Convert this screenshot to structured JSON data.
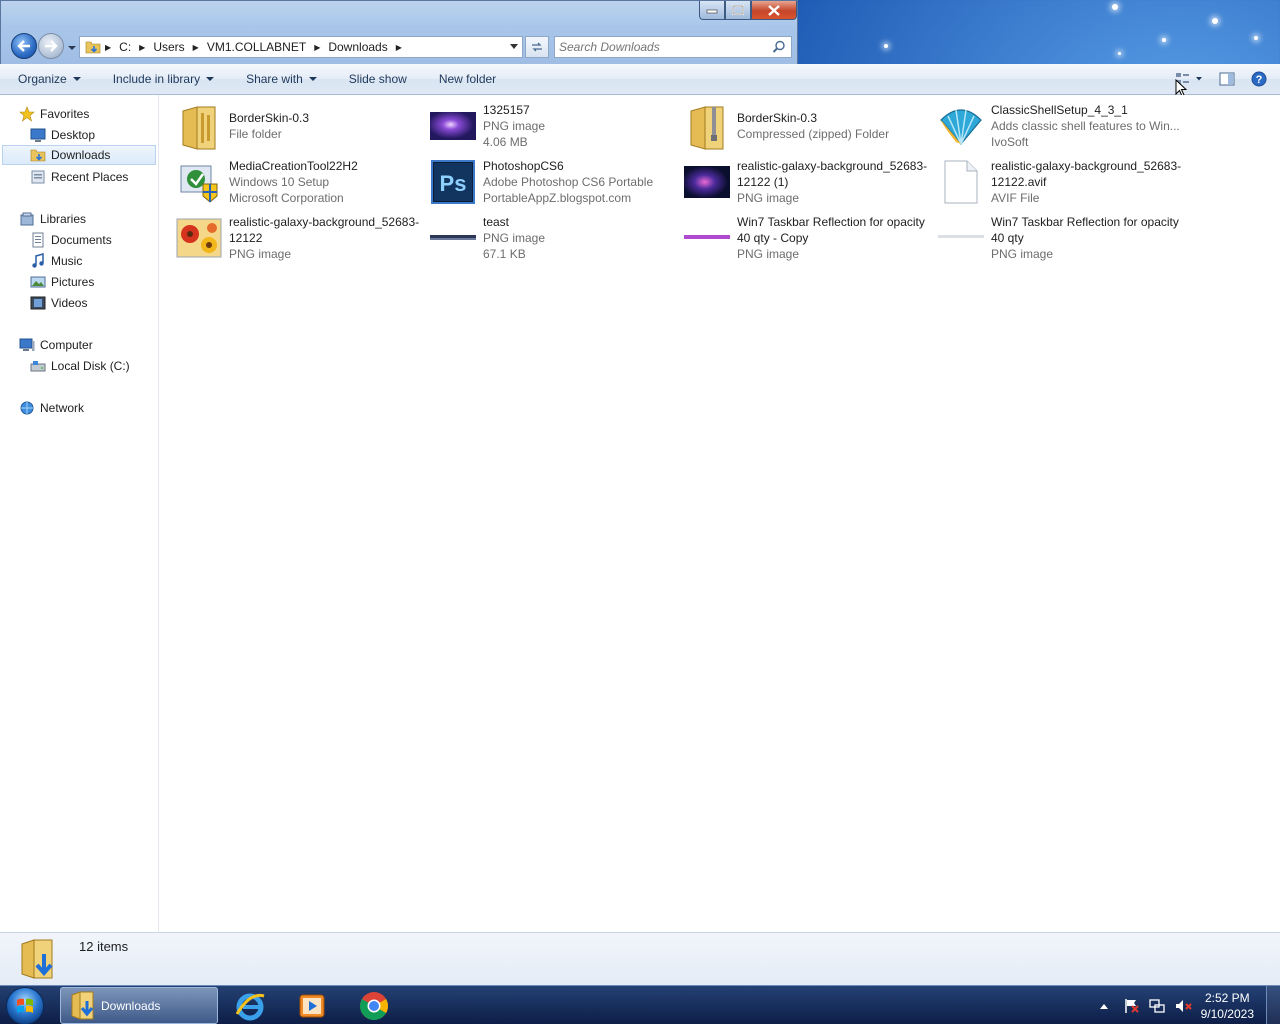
{
  "window": {
    "address": {
      "crumbs": [
        "C:",
        "Users",
        "VM1.COLLABNET",
        "Downloads"
      ]
    },
    "search": {
      "placeholder": "Search Downloads"
    },
    "caption": {
      "minimize": "minimize",
      "maximize": "maximize",
      "close": "close"
    }
  },
  "toolbar": {
    "organize": "Organize",
    "include_in_library": "Include in library",
    "share_with": "Share with",
    "slide_show": "Slide show",
    "new_folder": "New folder"
  },
  "navpane": {
    "favorites": "Favorites",
    "desktop": "Desktop",
    "downloads": "Downloads",
    "recent_places": "Recent Places",
    "libraries": "Libraries",
    "documents": "Documents",
    "music": "Music",
    "pictures": "Pictures",
    "videos": "Videos",
    "computer": "Computer",
    "local_disk": "Local Disk (C:)",
    "network": "Network"
  },
  "files": [
    {
      "name": "BorderSkin-0.3",
      "line1": "File folder",
      "line2": "",
      "icon": "folder-icon"
    },
    {
      "name": "1325157",
      "line1": "PNG image",
      "line2": "4.06 MB",
      "icon": "galaxy-thumbnail"
    },
    {
      "name": "BorderSkin-0.3",
      "line1": "Compressed (zipped) Folder",
      "line2": "",
      "icon": "zip-folder-icon"
    },
    {
      "name": "ClassicShellSetup_4_3_1",
      "line1": "Adds classic shell features to Win...",
      "line2": "IvoSoft",
      "icon": "shell-icon"
    },
    {
      "name": "MediaCreationTool22H2",
      "line1": "Windows 10 Setup",
      "line2": "Microsoft Corporation",
      "icon": "setup-icon"
    },
    {
      "name": "PhotoshopCS6",
      "line1": "Adobe Photoshop CS6 Portable",
      "line2": "PortableAppZ.blogspot.com",
      "icon": "photoshop-icon"
    },
    {
      "name": "realistic-galaxy-background_52683-12122 (1)",
      "line1": "PNG image",
      "line2": "",
      "icon": "galaxy-thumbnail"
    },
    {
      "name": "realistic-galaxy-background_52683-12122.avif",
      "line1": "AVIF File",
      "line2": "",
      "icon": "blank-file-icon"
    },
    {
      "name": "realistic-galaxy-background_52683-12122",
      "line1": "PNG image",
      "line2": "",
      "icon": "flowers-thumbnail"
    },
    {
      "name": "teast",
      "line1": "PNG image",
      "line2": "67.1 KB",
      "icon": "dark-strip-thumbnail"
    },
    {
      "name": "Win7 Taskbar Reflection for opacity 40 qty  - Copy",
      "line1": "PNG image",
      "line2": "",
      "icon": "purple-strip-thumbnail"
    },
    {
      "name": "Win7 Taskbar Reflection for opacity 40 qty",
      "line1": "PNG image",
      "line2": "",
      "icon": "light-strip-thumbnail"
    }
  ],
  "details": {
    "count": "12 items"
  },
  "taskbar": {
    "explorer_label": "Downloads",
    "time": "2:52 PM",
    "date": "9/10/2023"
  },
  "colors": {
    "accent": "#1e395b",
    "selection": "#dceafa",
    "secondary_text": "#6d6d6d"
  }
}
